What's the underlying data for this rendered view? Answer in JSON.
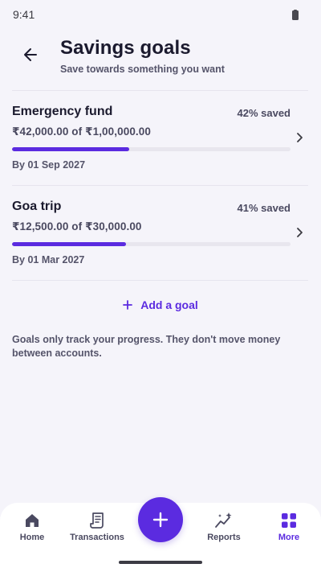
{
  "status_bar": {
    "time": "9:41"
  },
  "header": {
    "title": "Savings goals",
    "subtitle": "Save towards something you want"
  },
  "colors": {
    "accent": "#5b2be0",
    "track": "#e8e6ee",
    "background": "#f5f4fa"
  },
  "goals": [
    {
      "name": "Emergency fund",
      "percent_label": "42% saved",
      "progress_percent": 42,
      "amount": "₹42,000.00 of ₹1,00,000.00",
      "target_date": "By 01 Sep 2027"
    },
    {
      "name": "Goa trip",
      "percent_label": "41% saved",
      "progress_percent": 41,
      "amount": "₹12,500.00 of ₹30,000.00",
      "target_date": "By 01 Mar 2027"
    }
  ],
  "add_goal": {
    "label": "Add a goal"
  },
  "note": "Goals only track your progress. They don't move money between accounts.",
  "bottom_nav": {
    "items": [
      {
        "label": "Home",
        "icon": "home-icon"
      },
      {
        "label": "Transactions",
        "icon": "receipt-icon"
      },
      {
        "label": "Reports",
        "icon": "sparkline-icon"
      },
      {
        "label": "More",
        "icon": "grid-icon",
        "active": true
      }
    ],
    "fab_icon": "plus-icon"
  }
}
